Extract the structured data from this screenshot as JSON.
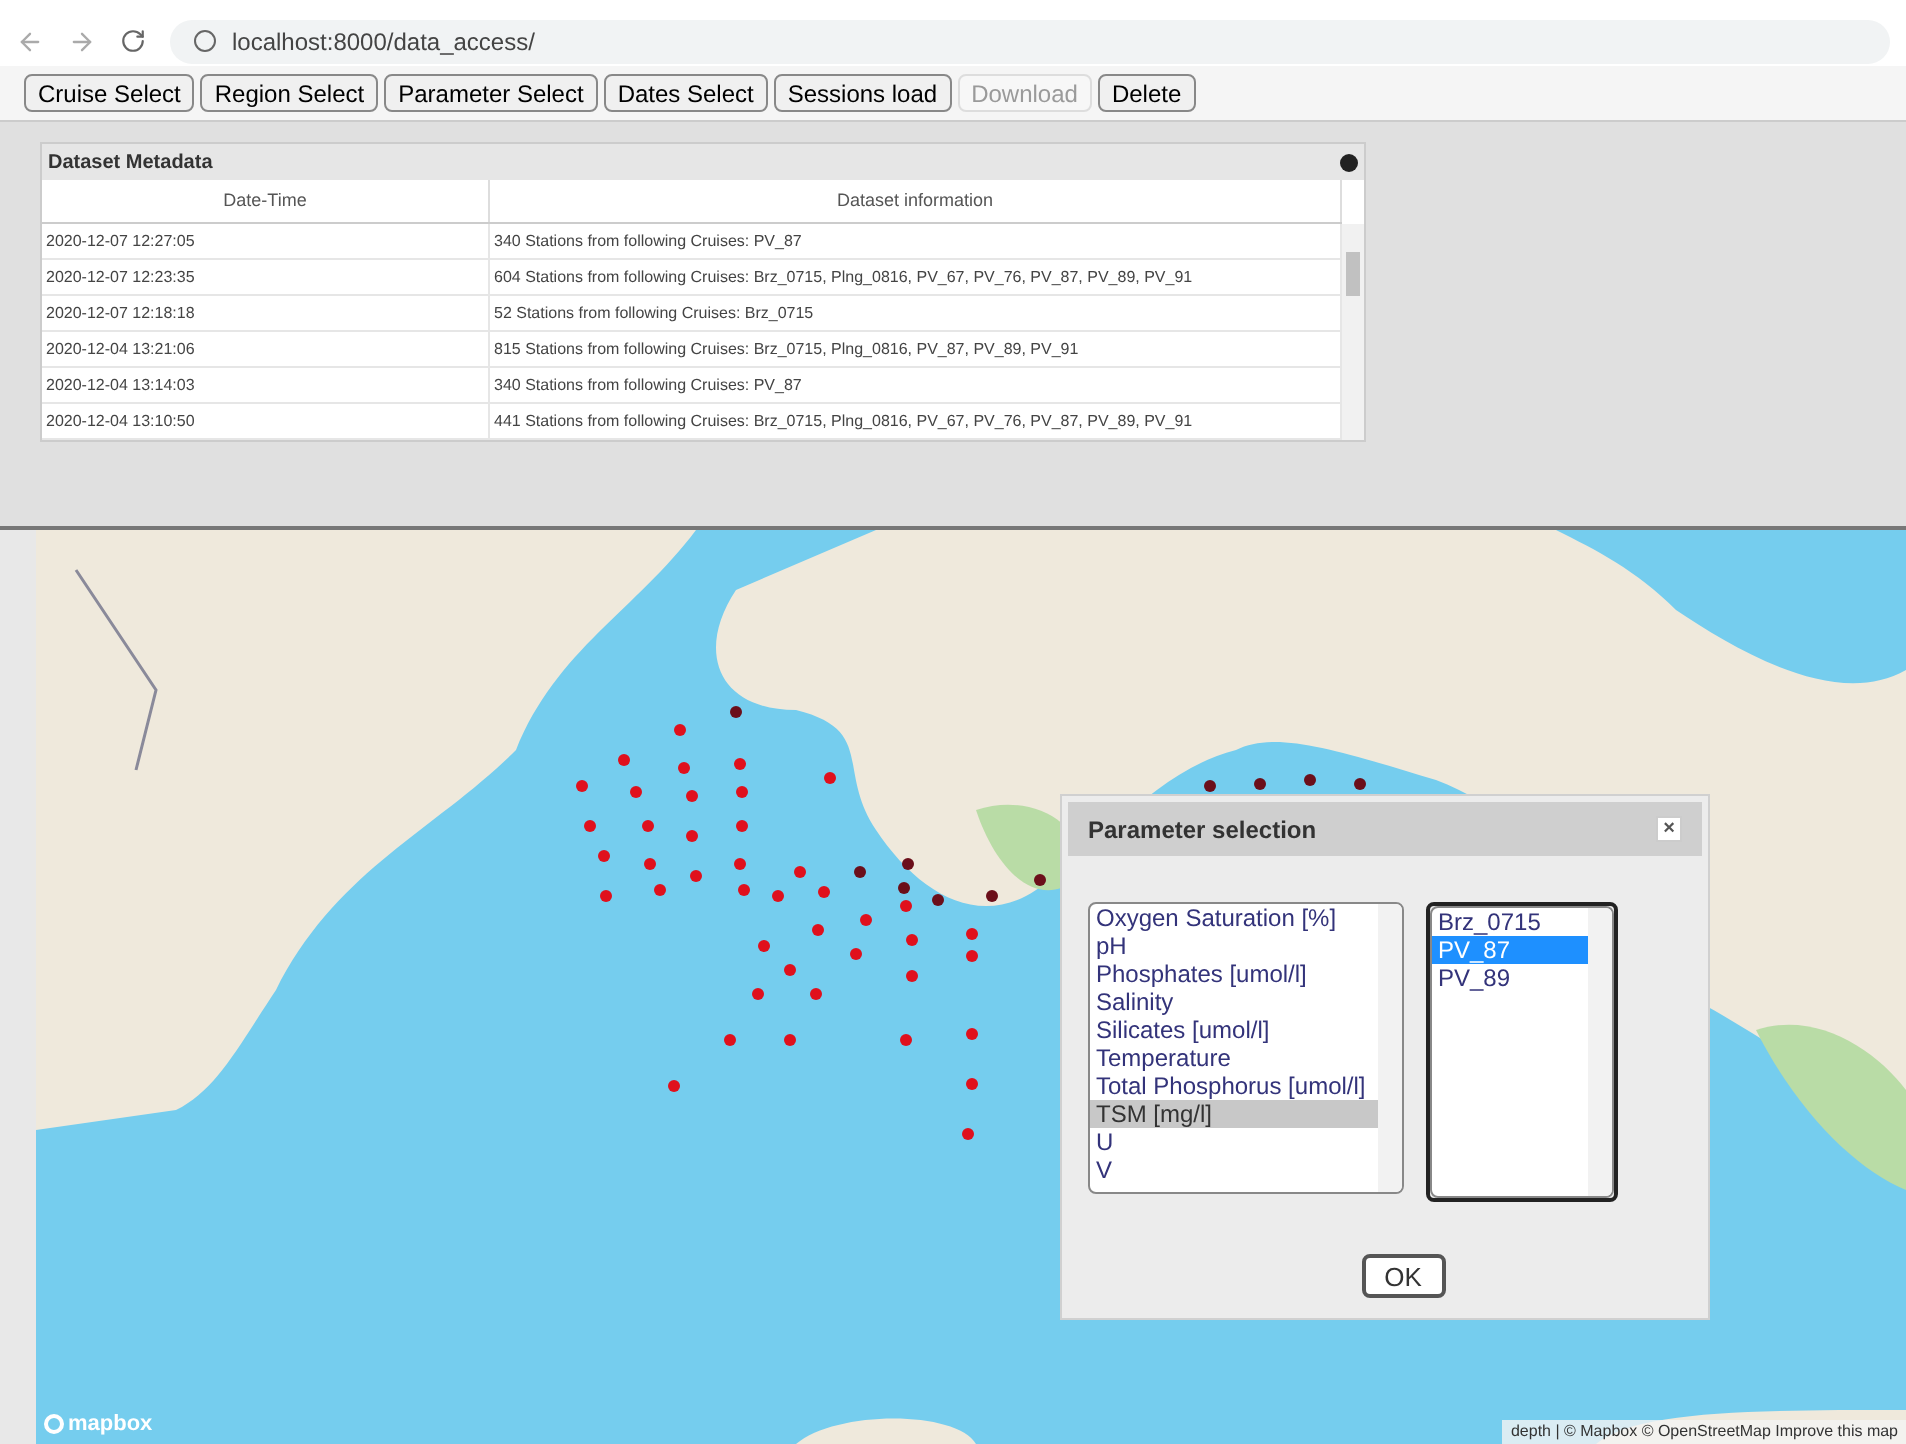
{
  "browser": {
    "url": "localhost:8000/data_access/"
  },
  "toolbar": [
    {
      "label": "Cruise Select",
      "disabled": false
    },
    {
      "label": "Region Select",
      "disabled": false
    },
    {
      "label": "Parameter Select",
      "disabled": false
    },
    {
      "label": "Dates Select",
      "disabled": false
    },
    {
      "label": "Sessions load",
      "disabled": false
    },
    {
      "label": "Download",
      "disabled": true
    },
    {
      "label": "Delete",
      "disabled": false
    }
  ],
  "metadata": {
    "title": "Dataset Metadata",
    "columns": [
      "Date-Time",
      "Dataset information"
    ],
    "rows": [
      [
        "2020-12-07 12:27:05",
        "340 Stations from following Cruises: PV_87"
      ],
      [
        "2020-12-07 12:23:35",
        "604 Stations from following Cruises: Brz_0715, Plng_0816, PV_67, PV_76, PV_87, PV_89, PV_91"
      ],
      [
        "2020-12-07 12:18:18",
        "52 Stations from following Cruises: Brz_0715"
      ],
      [
        "2020-12-04 13:21:06",
        "815 Stations from following Cruises: Brz_0715, Plng_0816, PV_87, PV_89, PV_91"
      ],
      [
        "2020-12-04 13:14:03",
        "340 Stations from following Cruises: PV_87"
      ],
      [
        "2020-12-04 13:10:50",
        "441 Stations from following Cruises: Brz_0715, Plng_0816, PV_67, PV_76, PV_87, PV_89, PV_91"
      ]
    ]
  },
  "map": {
    "kind": "picture",
    "logo": "mapbox",
    "attribution": "depth | © Mapbox © OpenStreetMap Improve this map"
  },
  "dialog": {
    "title": "Parameter selection",
    "close": "×",
    "parameters": [
      {
        "label": "Oxygen Saturation [%]",
        "selected": false
      },
      {
        "label": "pH",
        "selected": false
      },
      {
        "label": "Phosphates [umol/l]",
        "selected": false
      },
      {
        "label": "Salinity",
        "selected": false
      },
      {
        "label": "Silicates [umol/l]",
        "selected": false
      },
      {
        "label": "Temperature",
        "selected": false
      },
      {
        "label": "Total Phosphorus [umol/l]",
        "selected": false
      },
      {
        "label": "TSM [mg/l]",
        "selected": true
      },
      {
        "label": "U",
        "selected": false
      },
      {
        "label": "V",
        "selected": false
      }
    ],
    "cruises": [
      {
        "label": "Brz_0715",
        "selected": false
      },
      {
        "label": "PV_87",
        "selected": true
      },
      {
        "label": "PV_89",
        "selected": false
      }
    ],
    "ok": "OK"
  }
}
